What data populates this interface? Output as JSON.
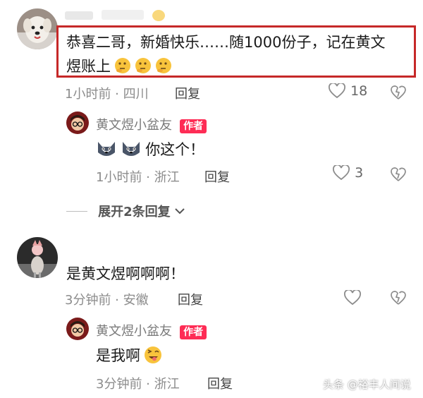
{
  "comments": [
    {
      "username": "",
      "text_line1": "恭喜二哥，新婚快乐……随1000份子，记在黄文",
      "text_line2": "煜账上",
      "emojis": [
        "thinking-face-icon",
        "thinking-face-icon",
        "thinking-face-icon"
      ],
      "meta": "1小时前 · 四川",
      "reply_label": "回复",
      "like_count": "18",
      "highlight_color": "#c62828",
      "reply": {
        "username": "黄文煜小盆友",
        "badge": "作者",
        "text": "你这个！",
        "emojis": [
          "husky-icon",
          "husky-icon"
        ],
        "meta": "1小时前 · 浙江",
        "reply_label": "回复",
        "like_count": "3"
      },
      "expand_label": "展开2条回复"
    },
    {
      "text": "是黄文煜啊啊啊！",
      "meta": "3分钟前 · 安徽",
      "reply_label": "回复",
      "reply": {
        "username": "黄文煜小盆友",
        "badge": "作者",
        "text": "是我啊",
        "emoji": "wink-tongue-icon",
        "meta": "3分钟前 · 浙江",
        "reply_label": "回复"
      }
    }
  ],
  "watermark": "头条 @裕丰人间说",
  "colors": {
    "accent": "#fe2c55",
    "highlight": "#c62828"
  }
}
